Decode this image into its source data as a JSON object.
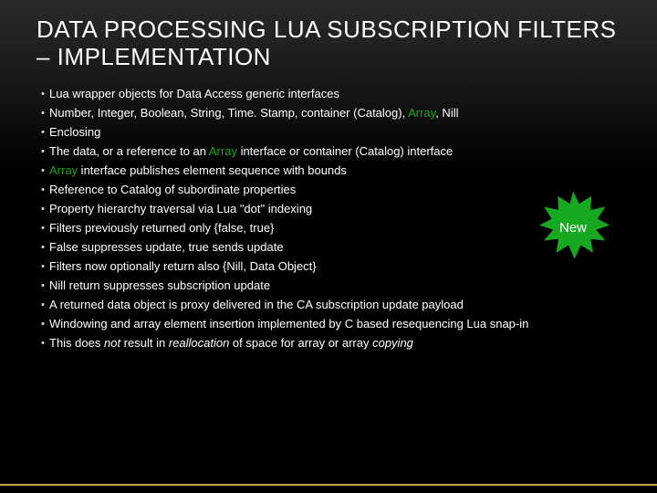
{
  "title_line1": "DATA PROCESSING LUA SUBSCRIPTION FILTERS",
  "title_line2": "– IMPLEMENTATION",
  "starburst": {
    "label": "New",
    "fill": "#16a820"
  },
  "b": {
    "p1": "Lua wrapper objects for Data Access generic interfaces",
    "p1_1a": "Number, Integer, Boolean, String, Time. Stamp, container (Catalog), ",
    "p1_1b": "Array",
    "p1_1c": ", Nill",
    "p1_2": "Enclosing",
    "p1_2_1a": "The data, or a reference to an ",
    "p1_2_1b": "Array",
    "p1_2_1c": " interface or container (Catalog) interface",
    "p1_2_1_1a": "Array",
    "p1_2_1_1b": " interface publishes element sequence with bounds",
    "p1_2_2": "Reference to Catalog of subordinate properties",
    "p1_3": "Property hierarchy traversal via Lua \"dot\" indexing",
    "p2": "Filters previously returned only {false, true}",
    "p2_1": "False suppresses update, true sends update",
    "p3": "Filters now optionally return also {Nill, Data Object}",
    "p3_1": "Nill return suppresses subscription update",
    "p3_2": "A returned data object is proxy delivered in the CA subscription update payload",
    "p3_3": "Windowing and array element insertion implemented by C based  resequencing Lua snap-in",
    "p3_3_1a": "This does ",
    "p3_3_1b": "not",
    "p3_3_1c": " result in ",
    "p3_3_1d": "reallocation",
    "p3_3_1e": " of space for array or array ",
    "p3_3_1f": "copying"
  }
}
